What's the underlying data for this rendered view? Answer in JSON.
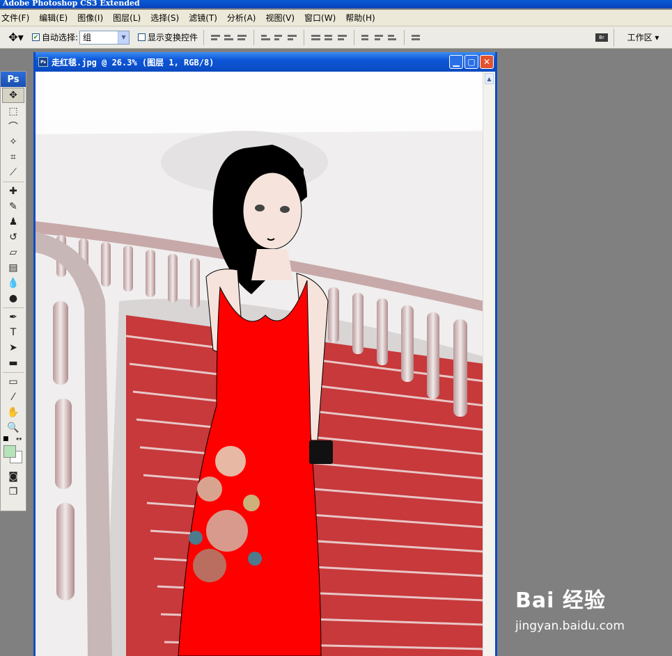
{
  "app": {
    "title": "Adobe Photoshop CS3 Extended"
  },
  "menu": [
    {
      "label": "文件(F)"
    },
    {
      "label": "编辑(E)"
    },
    {
      "label": "图像(I)"
    },
    {
      "label": "图层(L)"
    },
    {
      "label": "选择(S)"
    },
    {
      "label": "滤镜(T)"
    },
    {
      "label": "分析(A)"
    },
    {
      "label": "视图(V)"
    },
    {
      "label": "窗口(W)"
    },
    {
      "label": "帮助(H)"
    }
  ],
  "options": {
    "auto_select_label": "自动选择:",
    "auto_select_value": "组",
    "show_transform_label": "显示变换控件",
    "workspace_label": "工作区",
    "bridge_label": "Br"
  },
  "toolbox": {
    "logo": "Ps"
  },
  "document": {
    "title": "走红毯.jpg @ 26.3% (图层 1, RGB/8)"
  },
  "watermark": {
    "logo": "Bai 经验",
    "url": "jingyan.baidu.com"
  },
  "colors": {
    "foreground": "#b7e3bb",
    "background": "#ffffff",
    "dress": "#ff0000",
    "carpet": "#c8383a"
  }
}
